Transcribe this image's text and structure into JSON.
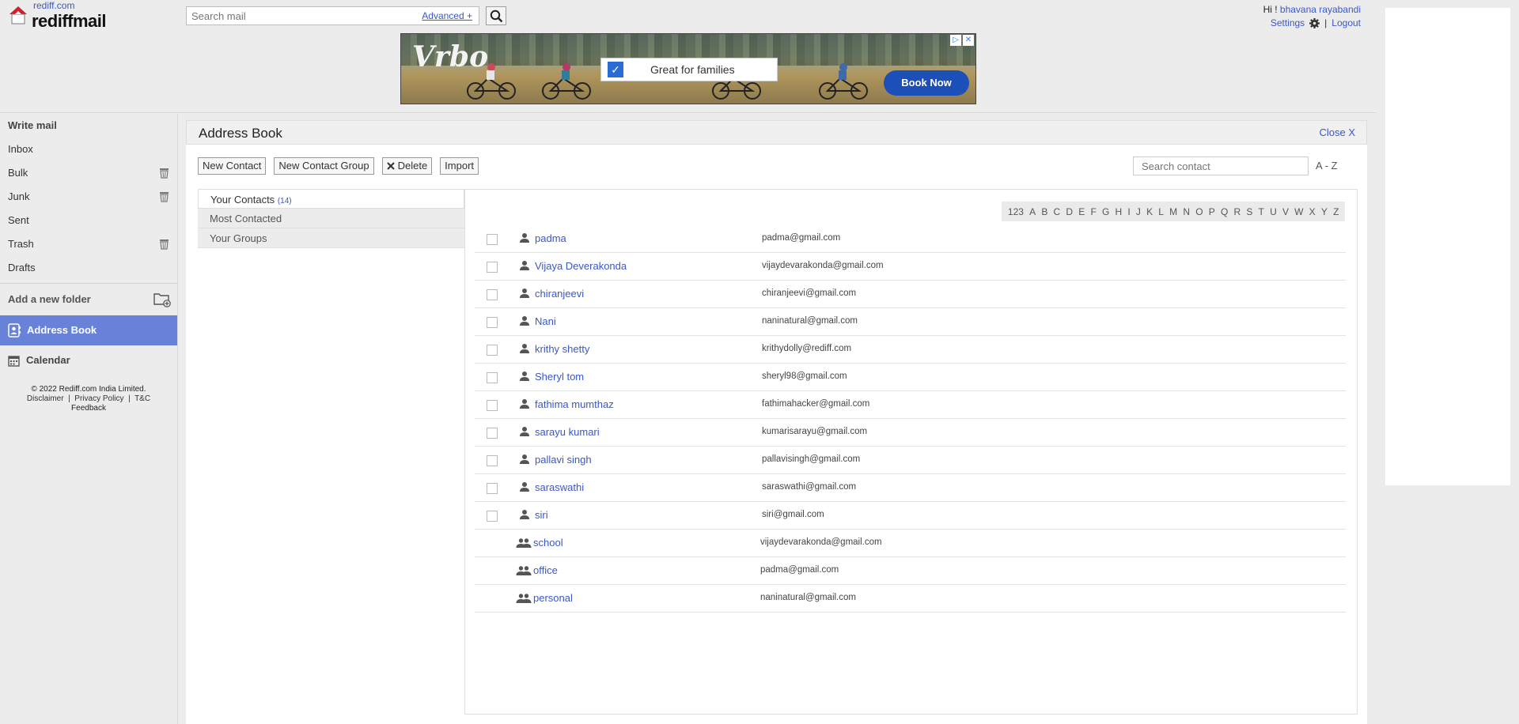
{
  "header": {
    "site_link": "rediff.com",
    "brand": "rediffmail",
    "search_placeholder": "Search mail",
    "advanced_label": "Advanced +",
    "greeting": "Hi !",
    "user_name": "bhavana rayabandi",
    "settings_label": "Settings",
    "logout_label": "Logout"
  },
  "ad": {
    "brand": "Vrbo",
    "tagline": "Great for families",
    "cta": "Book Now"
  },
  "sidebar": {
    "write_mail": "Write mail",
    "items": [
      {
        "label": "Inbox"
      },
      {
        "label": "Bulk"
      },
      {
        "label": "Junk"
      },
      {
        "label": "Sent"
      },
      {
        "label": "Trash"
      },
      {
        "label": "Drafts"
      }
    ],
    "add_folder": "Add a new folder",
    "address_book": "Address Book",
    "calendar": "Calendar",
    "footer": {
      "copyright": "© 2022 Rediff.com India Limited.",
      "disclaimer": "Disclaimer",
      "privacy": "Privacy Policy",
      "tc": "T&C",
      "feedback": "Feedback"
    }
  },
  "address_book": {
    "title": "Address Book",
    "close_label": "Close X",
    "toolbar": {
      "new_contact": "New Contact",
      "new_group": "New Contact Group",
      "delete": "Delete",
      "import": "Import"
    },
    "search_placeholder": "Search contact",
    "sort_label": "A - Z",
    "lists": {
      "your_contacts": "Your Contacts",
      "contacts_count": "(14)",
      "most_contacted": "Most Contacted",
      "your_groups": "Your Groups"
    },
    "alphabet": [
      "123",
      "A",
      "B",
      "C",
      "D",
      "E",
      "F",
      "G",
      "H",
      "I",
      "J",
      "K",
      "L",
      "M",
      "N",
      "O",
      "P",
      "Q",
      "R",
      "S",
      "T",
      "U",
      "V",
      "W",
      "X",
      "Y",
      "Z"
    ],
    "contacts": [
      {
        "name": "padma",
        "email": "padma@gmail.com"
      },
      {
        "name": "Vijaya Deverakonda",
        "email": "vijaydevarakonda@gmail.com"
      },
      {
        "name": "chiranjeevi",
        "email": "chiranjeevi@gmail.com"
      },
      {
        "name": "Nani",
        "email": "naninatural@gmail.com"
      },
      {
        "name": "krithy shetty",
        "email": "krithydolly@rediff.com"
      },
      {
        "name": "Sheryl tom",
        "email": "sheryl98@gmail.com"
      },
      {
        "name": "fathima mumthaz",
        "email": "fathimahacker@gmail.com"
      },
      {
        "name": "sarayu kumari",
        "email": "kumarisarayu@gmail.com"
      },
      {
        "name": "pallavi singh",
        "email": "pallavisingh@gmail.com"
      },
      {
        "name": "saraswathi",
        "email": "saraswathi@gmail.com"
      },
      {
        "name": "siri",
        "email": "siri@gmail.com"
      }
    ],
    "groups": [
      {
        "name": "school",
        "email": "vijaydevarakonda@gmail.com"
      },
      {
        "name": "office",
        "email": "padma@gmail.com"
      },
      {
        "name": "personal",
        "email": "naninatural@gmail.com"
      }
    ]
  }
}
